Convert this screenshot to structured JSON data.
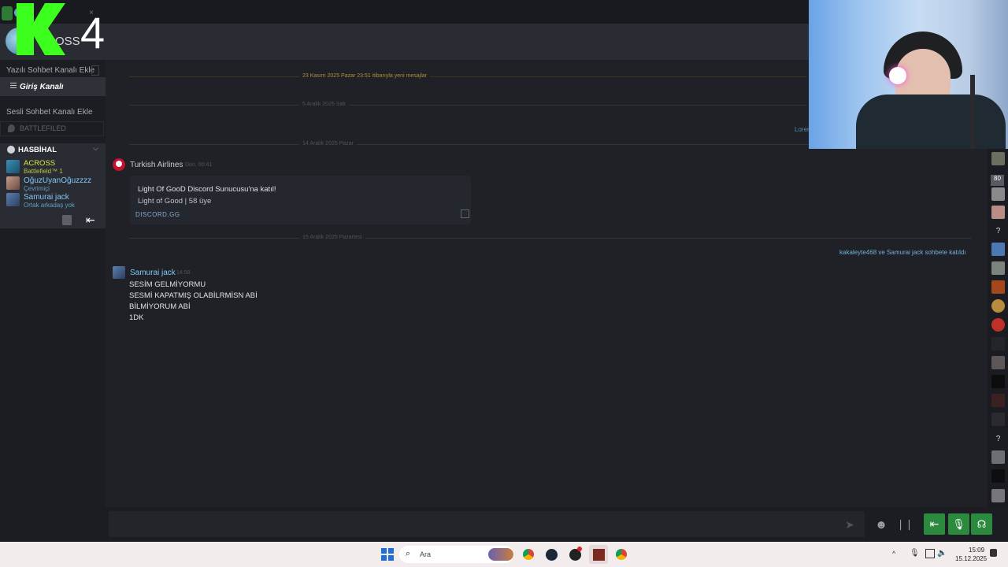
{
  "overlay": {
    "brand_number": "4",
    "title_fragment": "OSS"
  },
  "sidebar": {
    "text_channels_header": "Yazılı Sohbet Kanalı Ekle",
    "text_channel": "Giriş Kanalı",
    "voice_channels_header": "Sesli Sohbet Kanalı Ekle",
    "voice_channel_1": "BATTLEFILED",
    "voice_channel_2": "HASBİHAL",
    "members": [
      {
        "name": "ACROSS",
        "status": "Battlefield™ 1",
        "color": "#d9e94a"
      },
      {
        "name": "OğuzUyanOğuzzzz",
        "status": "Çevrimiçi",
        "color": "#7ec8f5"
      },
      {
        "name": "Samurai jack",
        "status": "Ortak arkadaş yok",
        "color": "#7ec8f5"
      }
    ]
  },
  "chat": {
    "new_messages_divider": "23 Kasım 2025 Pazar 23:51 itibarıyla yeni mesajlar",
    "date_1": "5 Aralık 2025 Salı",
    "partial_right": "Lorem",
    "date_2": "14 Aralık 2025 Pazar",
    "msg1": {
      "author": "Turkish Airlines",
      "time": "Dün, 00:41",
      "embed_title": "Light Of GooD Discord Sunucusu'na katıl!",
      "embed_sub": "Light of Good | 58 üye",
      "embed_link": "DISCORD.GG"
    },
    "date_3": "15 Aralık 2025 Pazartesi",
    "join_notice": "kakaleyte468 ve Samurai jack sohbete katıldı",
    "msg2": {
      "author": "Samurai jack",
      "time": "14:58",
      "lines": [
        "SESİM GELMİYORMU",
        "SESMİ KAPATMIŞ OLABİLRMİSN ABİ",
        "BİLMİYORUM ABİ",
        "1DK"
      ]
    }
  },
  "rail": {
    "badge_80": "80",
    "question_mark": "?"
  },
  "taskbar": {
    "search_placeholder": "Ara",
    "time": "15:09",
    "date": "15.12.2025"
  },
  "colors": {
    "accent_green": "#2b8a3e",
    "link_blue": "#7ec8f5",
    "overlay_green": "#3dff1e",
    "airline_red": "#c8102e"
  }
}
